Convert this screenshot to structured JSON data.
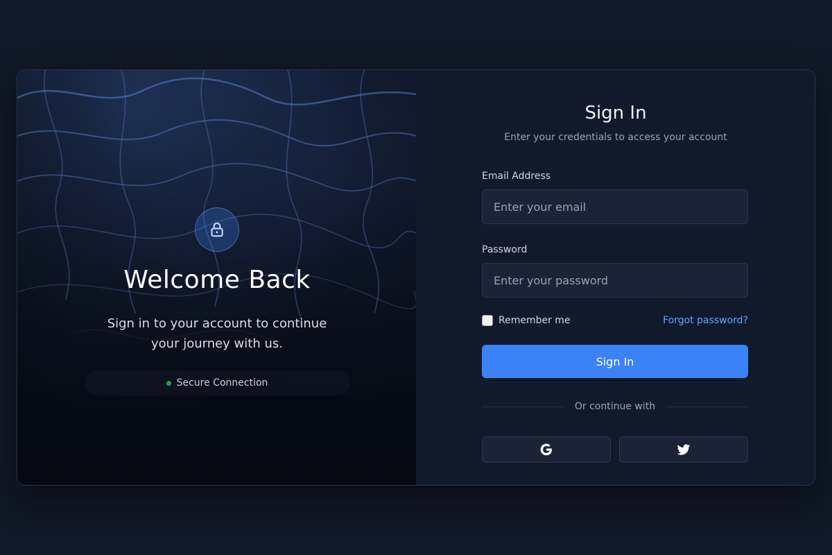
{
  "left_panel": {
    "title": "Welcome Back",
    "subtitle": "Sign in to your account to continue your journey with us.",
    "secure_label": "Secure Connection",
    "lock_icon": "lock-icon"
  },
  "form": {
    "title": "Sign In",
    "subtitle": "Enter your credentials to access your account",
    "email": {
      "label": "Email Address",
      "placeholder": "Enter your email",
      "value": ""
    },
    "password": {
      "label": "Password",
      "placeholder": "Enter your password",
      "value": ""
    },
    "remember_label": "Remember me",
    "remember_checked": false,
    "forgot_label": "Forgot password?",
    "submit_label": "Sign In",
    "divider_label": "Or continue with",
    "social": [
      {
        "name": "google",
        "icon": "google-icon"
      },
      {
        "name": "twitter",
        "icon": "twitter-icon"
      }
    ]
  },
  "colors": {
    "background": "#111827",
    "panel": "#111a2b",
    "accent": "#3b82f6",
    "link": "#60a5fa",
    "secure_dot": "#22a05a"
  }
}
